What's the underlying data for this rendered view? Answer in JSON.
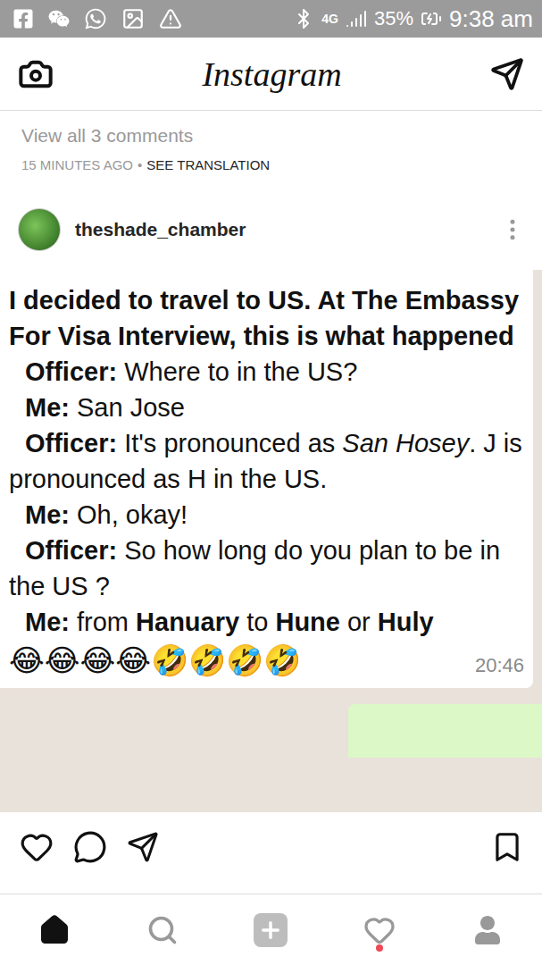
{
  "status_bar": {
    "network": "4G",
    "battery": "35%",
    "time": "9:38 am",
    "charging": true
  },
  "header": {
    "logo": "Instagram"
  },
  "comments": {
    "view_all": "View all 3 comments",
    "time": "15 MINUTES AGO",
    "separator": "•",
    "translate": "SEE TRANSLATION"
  },
  "post": {
    "username": "theshade_chamber",
    "liked": false,
    "saved": false,
    "message": {
      "heading": "I decided to travel to US. At The Embassy For Visa Interview, this is what happened",
      "lines": [
        {
          "speaker": "Officer:",
          "segments": [
            {
              "text": " Where to in the US?",
              "style": "plain"
            }
          ]
        },
        {
          "speaker": "Me:",
          "segments": [
            {
              "text": " San Jose",
              "style": "plain"
            }
          ]
        },
        {
          "speaker": "Officer:",
          "segments": [
            {
              "text": " It's pronounced as ",
              "style": "plain"
            },
            {
              "text": "San Hosey",
              "style": "italic"
            },
            {
              "text": ". J is pronounced as H in the US.",
              "style": "plain"
            }
          ]
        },
        {
          "speaker": "Me:",
          "segments": [
            {
              "text": " Oh, okay!",
              "style": "plain"
            }
          ]
        },
        {
          "speaker": "Officer:",
          "segments": [
            {
              "text": " So how long do you plan to be in the US ?",
              "style": "plain"
            }
          ]
        },
        {
          "speaker": "Me:",
          "segments": [
            {
              "text": " from ",
              "style": "plain"
            },
            {
              "text": "Hanuary",
              "style": "bold"
            },
            {
              "text": " to ",
              "style": "plain"
            },
            {
              "text": "Hune",
              "style": "bold"
            },
            {
              "text": " or ",
              "style": "plain"
            },
            {
              "text": "Huly",
              "style": "bold"
            }
          ]
        }
      ],
      "emoji": "😂😂😂😂🤣🤣🤣🤣",
      "time": "20:46"
    }
  },
  "bottom_nav": [
    {
      "kind": "home",
      "selected": true,
      "notification": false
    },
    {
      "kind": "search",
      "selected": false,
      "notification": false
    },
    {
      "kind": "new-post",
      "selected": false,
      "notification": false
    },
    {
      "kind": "activity",
      "selected": false,
      "notification": true
    },
    {
      "kind": "profile",
      "selected": false,
      "notification": false
    }
  ]
}
